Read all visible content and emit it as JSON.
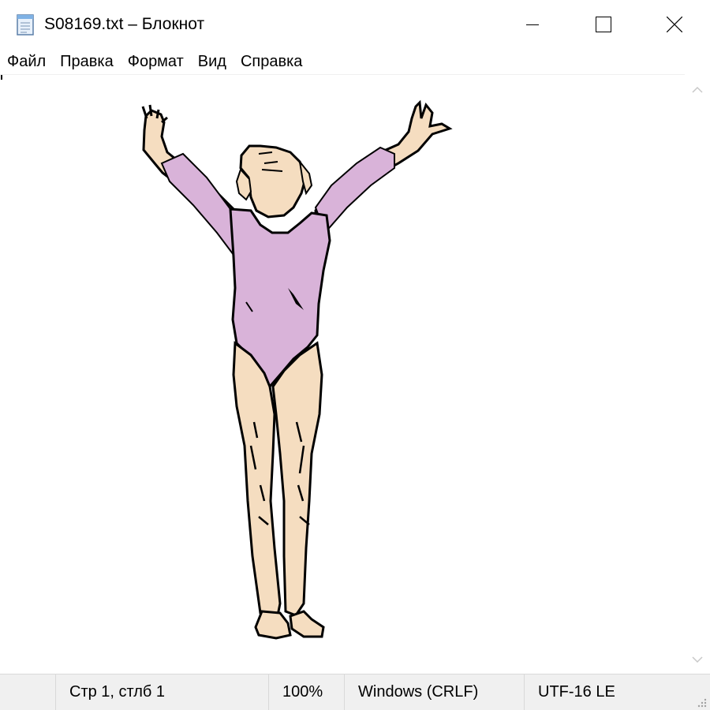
{
  "window": {
    "title": "S08169.txt – Блокнот",
    "app_icon": "notepad-icon",
    "buttons": {
      "minimize": "minimize-icon",
      "maximize": "maximize-icon",
      "close": "close-icon"
    }
  },
  "menu": {
    "items": [
      {
        "label": "Файл"
      },
      {
        "label": "Правка"
      },
      {
        "label": "Формат"
      },
      {
        "label": "Вид"
      },
      {
        "label": "Справка"
      }
    ]
  },
  "editor": {
    "content_description_icon": "gymnast-illustration",
    "colors": {
      "leotard": "#d9b3d9",
      "skin": "#f5ddc0",
      "outline": "#000000"
    }
  },
  "scrollbar": {
    "up": "chevron-up-icon",
    "down": "chevron-down-icon"
  },
  "status": {
    "position": "Стр 1, стлб 1",
    "zoom": "100%",
    "line_endings": "Windows (CRLF)",
    "encoding": "UTF-16 LE"
  }
}
